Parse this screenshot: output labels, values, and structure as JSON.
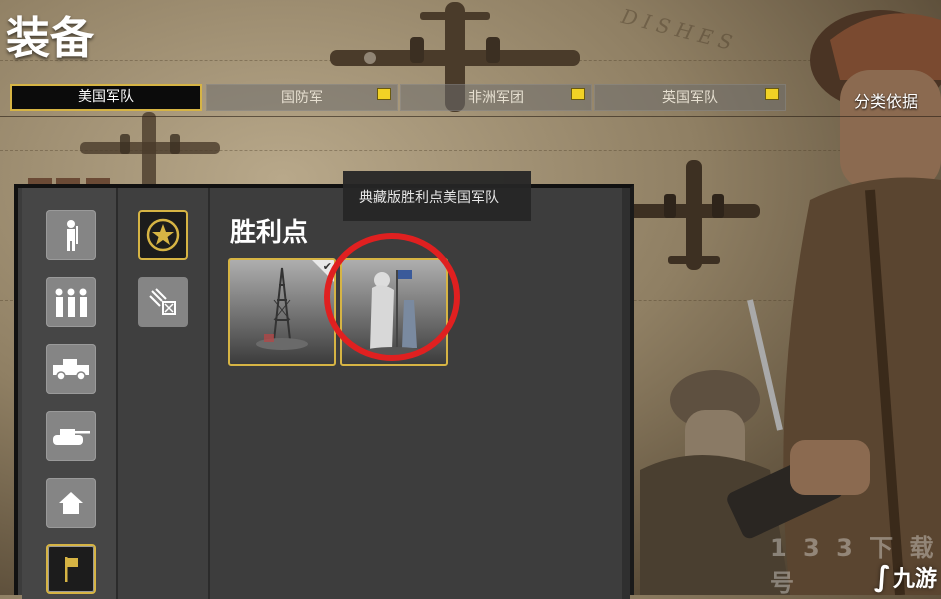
{
  "header": {
    "title": "装备",
    "sort_label": "分类依据",
    "tabs": [
      {
        "label": "美国军队",
        "active": true,
        "new_flag": false
      },
      {
        "label": "国防军",
        "active": false,
        "new_flag": true
      },
      {
        "label": "非洲军团",
        "active": false,
        "new_flag": true
      },
      {
        "label": "英国军队",
        "active": false,
        "new_flag": true
      }
    ]
  },
  "left_nav": {
    "items": [
      {
        "icon": "infantry-icon",
        "active": false
      },
      {
        "icon": "squad-icon",
        "active": false
      },
      {
        "icon": "jeep-icon",
        "active": false
      },
      {
        "icon": "tank-icon",
        "active": false
      },
      {
        "icon": "base-icon",
        "active": false
      },
      {
        "icon": "flag-icon",
        "active": true
      }
    ]
  },
  "sub_nav": {
    "items": [
      {
        "icon": "star-icon",
        "active": true
      },
      {
        "icon": "mortar-icon",
        "active": false
      }
    ]
  },
  "main": {
    "section_title": "胜利点",
    "items": [
      {
        "name": "tower-victory-point",
        "equipped": true
      },
      {
        "name": "statue-victory-point",
        "equipped": false
      }
    ],
    "tooltip": "典藏版胜利点美国军队"
  },
  "watermark": {
    "logo": "九游",
    "logo_glyph": "∫",
    "faint": "1 3 3 下 载 号"
  },
  "colors": {
    "accent": "#d6b444",
    "new_flag": "#f2d225",
    "highlight": "#e02020"
  }
}
